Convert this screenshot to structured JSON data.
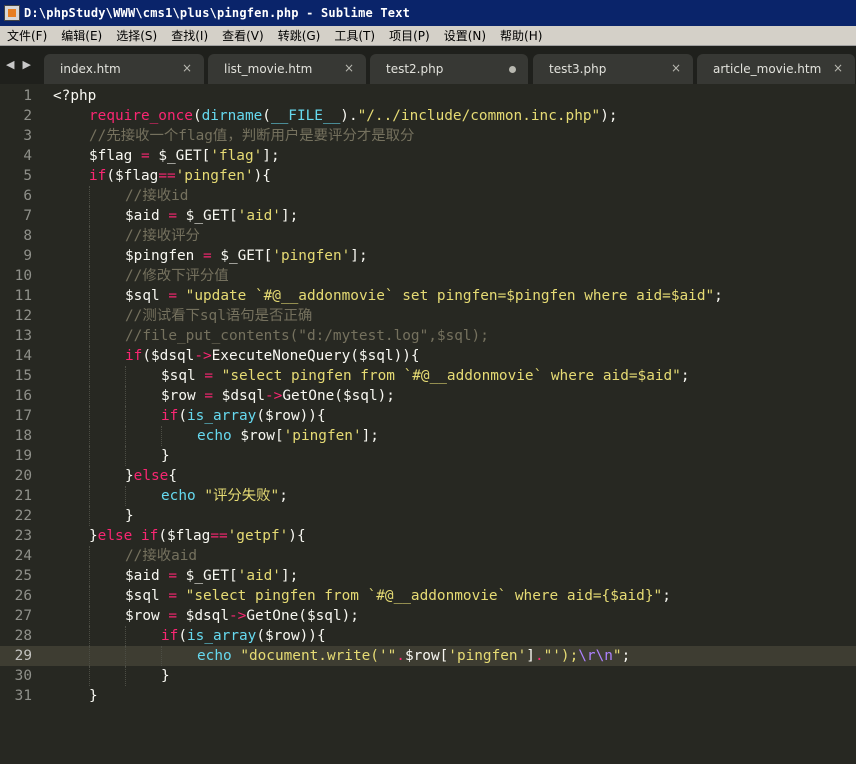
{
  "window": {
    "title": "D:\\phpStudy\\WWW\\cms1\\plus\\pingfen.php - Sublime Text"
  },
  "menu": [
    "文件(F)",
    "编辑(E)",
    "选择(S)",
    "查找(I)",
    "查看(V)",
    "转跳(G)",
    "工具(T)",
    "项目(P)",
    "设置(N)",
    "帮助(H)"
  ],
  "tabs": [
    {
      "label": "index.htm",
      "marker": "×",
      "active": false
    },
    {
      "label": "list_movie.htm",
      "marker": "×",
      "active": false
    },
    {
      "label": "test2.php",
      "marker": "dot",
      "active": false
    },
    {
      "label": "test3.php",
      "marker": "×",
      "active": false
    },
    {
      "label": "article_movie.htm",
      "marker": "×",
      "active": false
    }
  ],
  "tab_nav": {
    "left": "◀",
    "right": "▶"
  },
  "editor": {
    "current_line": 29,
    "lines": [
      {
        "n": "1",
        "indent": 0,
        "t": [
          [
            "pl",
            "<?php"
          ]
        ]
      },
      {
        "n": "2",
        "indent": 1,
        "t": [
          [
            "kw",
            "require_once"
          ],
          [
            "pl",
            "("
          ],
          [
            "fn",
            "dirname"
          ],
          [
            "pl",
            "("
          ],
          [
            "fn",
            "__FILE__"
          ],
          [
            "pl",
            ")."
          ],
          [
            "str",
            "\"/../include/common.inc.php\""
          ],
          [
            "pl",
            ");"
          ]
        ]
      },
      {
        "n": "3",
        "indent": 1,
        "t": [
          [
            "cm",
            "//先接收一个flag值，判断用户是要评分才是取分"
          ]
        ]
      },
      {
        "n": "4",
        "indent": 1,
        "t": [
          [
            "pl",
            "$flag "
          ],
          [
            "kw",
            "="
          ],
          [
            "pl",
            " $_GET["
          ],
          [
            "str",
            "'flag'"
          ],
          [
            "pl",
            "];"
          ]
        ]
      },
      {
        "n": "5",
        "indent": 1,
        "t": [
          [
            "kw",
            "if"
          ],
          [
            "pl",
            "($flag"
          ],
          [
            "kw",
            "=="
          ],
          [
            "str",
            "'pingfen'"
          ],
          [
            "pl",
            "){"
          ]
        ]
      },
      {
        "n": "6",
        "indent": 2,
        "t": [
          [
            "cm",
            "//接收id"
          ]
        ]
      },
      {
        "n": "7",
        "indent": 2,
        "t": [
          [
            "pl",
            "$aid "
          ],
          [
            "kw",
            "="
          ],
          [
            "pl",
            " $_GET["
          ],
          [
            "str",
            "'aid'"
          ],
          [
            "pl",
            "];"
          ]
        ]
      },
      {
        "n": "8",
        "indent": 2,
        "t": [
          [
            "cm",
            "//接收评分"
          ]
        ]
      },
      {
        "n": "9",
        "indent": 2,
        "t": [
          [
            "pl",
            "$pingfen "
          ],
          [
            "kw",
            "="
          ],
          [
            "pl",
            " $_GET["
          ],
          [
            "str",
            "'pingfen'"
          ],
          [
            "pl",
            "];"
          ]
        ]
      },
      {
        "n": "10",
        "indent": 2,
        "t": [
          [
            "cm",
            "//修改下评分值"
          ]
        ]
      },
      {
        "n": "11",
        "indent": 2,
        "t": [
          [
            "pl",
            "$sql "
          ],
          [
            "kw",
            "="
          ],
          [
            "str",
            " \"update `#@__addonmovie` set pingfen=$pingfen where aid=$aid\""
          ],
          [
            "pl",
            ";"
          ]
        ]
      },
      {
        "n": "12",
        "indent": 2,
        "t": [
          [
            "cm",
            "//测试看下sql语句是否正确"
          ]
        ]
      },
      {
        "n": "13",
        "indent": 2,
        "t": [
          [
            "cm",
            "//file_put_contents(\"d:/mytest.log\",$sql);"
          ]
        ]
      },
      {
        "n": "14",
        "indent": 2,
        "t": [
          [
            "kw",
            "if"
          ],
          [
            "pl",
            "($dsql"
          ],
          [
            "kw",
            "->"
          ],
          [
            "pl",
            "ExecuteNoneQuery($sql)){"
          ]
        ]
      },
      {
        "n": "15",
        "indent": 3,
        "t": [
          [
            "pl",
            "$sql "
          ],
          [
            "kw",
            "="
          ],
          [
            "str",
            " \"select pingfen from `#@__addonmovie` where aid=$aid\""
          ],
          [
            "pl",
            ";"
          ]
        ]
      },
      {
        "n": "16",
        "indent": 3,
        "t": [
          [
            "pl",
            "$row "
          ],
          [
            "kw",
            "="
          ],
          [
            "pl",
            " $dsql"
          ],
          [
            "kw",
            "->"
          ],
          [
            "pl",
            "GetOne($sql);"
          ]
        ]
      },
      {
        "n": "17",
        "indent": 3,
        "t": [
          [
            "kw",
            "if"
          ],
          [
            "pl",
            "("
          ],
          [
            "fn",
            "is_array"
          ],
          [
            "pl",
            "($row)){"
          ]
        ]
      },
      {
        "n": "18",
        "indent": 4,
        "t": [
          [
            "fn",
            "echo"
          ],
          [
            "pl",
            " $row["
          ],
          [
            "str",
            "'pingfen'"
          ],
          [
            "pl",
            "];"
          ]
        ]
      },
      {
        "n": "19",
        "indent": 3,
        "t": [
          [
            "pl",
            "}"
          ]
        ]
      },
      {
        "n": "20",
        "indent": 2,
        "t": [
          [
            "pl",
            "}"
          ],
          [
            "kw",
            "else"
          ],
          [
            "pl",
            "{"
          ]
        ]
      },
      {
        "n": "21",
        "indent": 3,
        "t": [
          [
            "fn",
            "echo"
          ],
          [
            "str",
            " \"评分失败\""
          ],
          [
            "pl",
            ";"
          ]
        ]
      },
      {
        "n": "22",
        "indent": 2,
        "t": [
          [
            "pl",
            "}"
          ]
        ]
      },
      {
        "n": "23",
        "indent": 1,
        "t": [
          [
            "pl",
            "}"
          ],
          [
            "kw",
            "else if"
          ],
          [
            "pl",
            "($flag"
          ],
          [
            "kw",
            "=="
          ],
          [
            "str",
            "'getpf'"
          ],
          [
            "pl",
            "){"
          ]
        ]
      },
      {
        "n": "24",
        "indent": 2,
        "t": [
          [
            "cm",
            "//接收aid"
          ]
        ]
      },
      {
        "n": "25",
        "indent": 2,
        "t": [
          [
            "pl",
            "$aid "
          ],
          [
            "kw",
            "="
          ],
          [
            "pl",
            " $_GET["
          ],
          [
            "str",
            "'aid'"
          ],
          [
            "pl",
            "];"
          ]
        ]
      },
      {
        "n": "26",
        "indent": 2,
        "t": [
          [
            "pl",
            "$sql "
          ],
          [
            "kw",
            "="
          ],
          [
            "str",
            " \"select pingfen from `#@__addonmovie` where aid={$aid}\""
          ],
          [
            "pl",
            ";"
          ]
        ]
      },
      {
        "n": "27",
        "indent": 2,
        "t": [
          [
            "pl",
            "$row "
          ],
          [
            "kw",
            "="
          ],
          [
            "pl",
            " $dsql"
          ],
          [
            "kw",
            "->"
          ],
          [
            "pl",
            "GetOne($sql);"
          ]
        ]
      },
      {
        "n": "28",
        "indent": 3,
        "t": [
          [
            "kw",
            "if"
          ],
          [
            "pl",
            "("
          ],
          [
            "fn",
            "is_array"
          ],
          [
            "pl",
            "($row)){"
          ]
        ]
      },
      {
        "n": "29",
        "indent": 4,
        "t": [
          [
            "fn",
            "echo"
          ],
          [
            "str",
            " \"document.write('\""
          ],
          [
            "kw",
            "."
          ],
          [
            "pl",
            "$row["
          ],
          [
            "str",
            "'pingfen'"
          ],
          [
            "pl",
            "]"
          ],
          [
            "kw",
            "."
          ],
          [
            "str",
            "\"');"
          ],
          [
            "const",
            "\\r\\n"
          ],
          [
            "str",
            "\""
          ],
          [
            "pl",
            ";"
          ]
        ]
      },
      {
        "n": "30",
        "indent": 3,
        "t": [
          [
            "pl",
            "}"
          ]
        ]
      },
      {
        "n": "31",
        "indent": 1,
        "t": [
          [
            "pl",
            "}"
          ]
        ]
      }
    ]
  }
}
